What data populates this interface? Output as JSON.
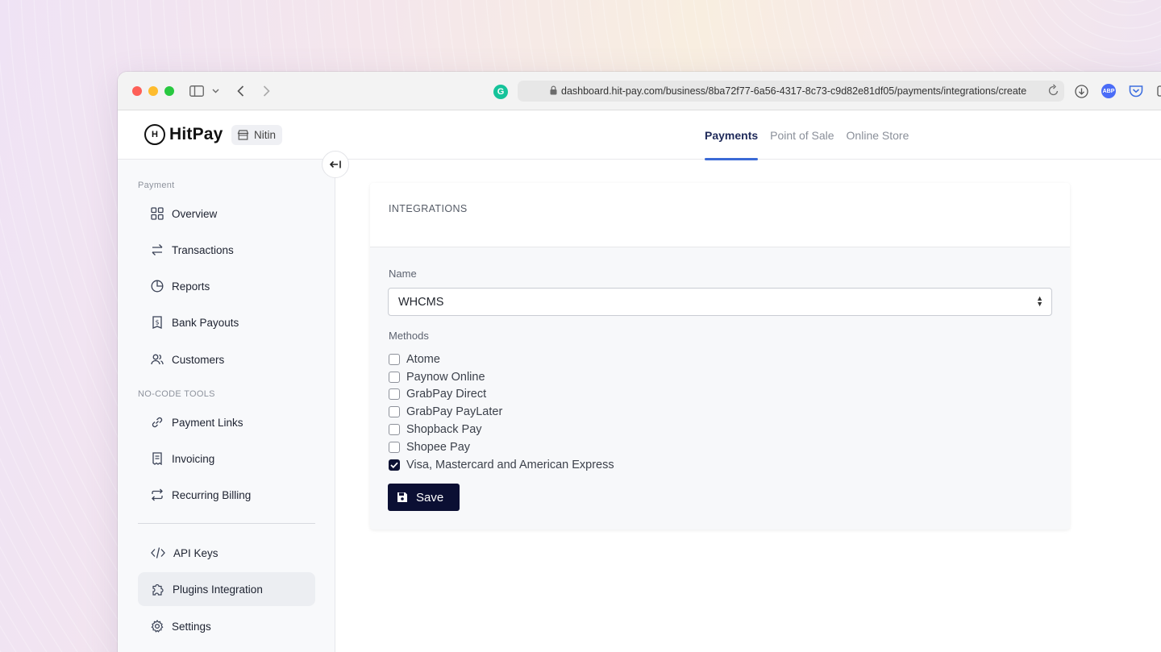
{
  "browser": {
    "url": "dashboard.hit-pay.com/business/8ba72f77-6a56-4317-8c73-c9d82e81df05/payments/integrations/create",
    "extension_badge": "ABP",
    "grammarly_letter": "G"
  },
  "header": {
    "logo_text": "HitPay",
    "logo_mark": "H",
    "business_name": "Nitin",
    "tabs": [
      {
        "label": "Payments",
        "active": true
      },
      {
        "label": "Point of Sale",
        "active": false
      },
      {
        "label": "Online Store",
        "active": false
      }
    ]
  },
  "sidebar": {
    "collapse_glyph": "←|",
    "section_payment": "Payment",
    "section_tools": "NO-CODE TOOLS",
    "items": [
      {
        "label": "Overview",
        "icon": "grid-icon"
      },
      {
        "label": "Transactions",
        "icon": "arrows-exchange-icon"
      },
      {
        "label": "Reports",
        "icon": "pie-chart-icon"
      },
      {
        "label": "Bank Payouts",
        "icon": "dollar-document-icon"
      },
      {
        "label": "Customers",
        "icon": "users-icon"
      },
      {
        "label": "Payment Links",
        "icon": "link-icon"
      },
      {
        "label": "Invoicing",
        "icon": "receipt-icon"
      },
      {
        "label": "Recurring Billing",
        "icon": "repeat-icon"
      },
      {
        "label": "API Keys",
        "icon": "code-icon"
      },
      {
        "label": "Plugins Integration",
        "icon": "puzzle-icon",
        "active": true
      },
      {
        "label": "Settings",
        "icon": "gear-icon"
      }
    ]
  },
  "main": {
    "card_title": "INTEGRATIONS",
    "name_label": "Name",
    "name_value": "WHCMS",
    "methods_label": "Methods",
    "methods": [
      {
        "label": "Atome",
        "checked": false
      },
      {
        "label": "Paynow Online",
        "checked": false
      },
      {
        "label": "GrabPay Direct",
        "checked": false
      },
      {
        "label": "GrabPay PayLater",
        "checked": false
      },
      {
        "label": "Shopback Pay",
        "checked": false
      },
      {
        "label": "Shopee Pay",
        "checked": false
      },
      {
        "label": "Visa, Mastercard and American Express",
        "checked": true
      }
    ],
    "save_label": "Save"
  },
  "colors": {
    "accent": "#3b6ad6",
    "primary_button": "#0b0f33"
  }
}
